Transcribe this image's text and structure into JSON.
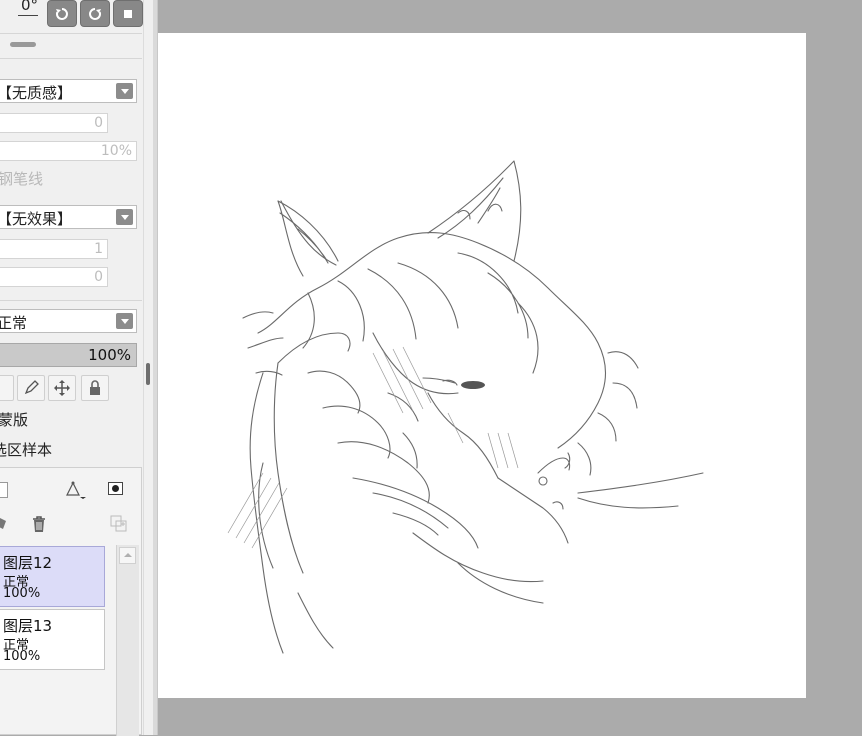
{
  "panel": {
    "rotation_value": "0°",
    "texture_label": "【无质感】",
    "texture_value": "0",
    "texture_percent": "10%",
    "pen_line_label": "钢笔线",
    "effect_label": "【无效果】",
    "effect_value1": "1",
    "effect_value2": "0",
    "blend_mode": "正常",
    "opacity": "100%",
    "clip_mask_label": "蒙版",
    "sample_label": "选区样本"
  },
  "layers": [
    {
      "name": "图层12",
      "mode": "正常",
      "opacity": "100%",
      "selected": true
    },
    {
      "name": "图层13",
      "mode": "正常",
      "opacity": "100%",
      "selected": false
    }
  ],
  "icons": {
    "rotate_ccw": "rotate-ccw-icon",
    "rotate_cw": "rotate-cw-icon",
    "reset": "reset-icon",
    "pencil": "pencil-icon",
    "move": "move-icon",
    "lock": "lock-icon",
    "trash": "trash-icon"
  },
  "colors": {
    "panel_bg": "#f0f0f0",
    "workspace_bg": "#ababab",
    "selected_layer": "#dcdcf8"
  }
}
